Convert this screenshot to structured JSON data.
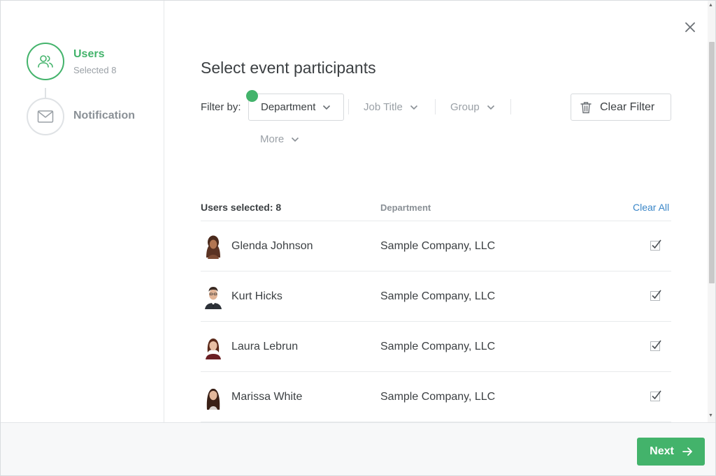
{
  "sidebar": {
    "steps": [
      {
        "title": "Users",
        "subtitle": "Selected 8",
        "icon": "users-icon",
        "active": true
      },
      {
        "title": "Notification",
        "icon": "envelope-icon",
        "active": false
      }
    ]
  },
  "main": {
    "title": "Select event participants",
    "filter_label": "Filter by:",
    "filters": [
      {
        "label": "Department",
        "active": true
      },
      {
        "label": "Job Title",
        "active": false
      },
      {
        "label": "Group",
        "active": false
      },
      {
        "label": "More",
        "active": false
      }
    ],
    "clear_filter_label": "Clear Filter",
    "table": {
      "users_selected_label": "Users selected: 8",
      "department_header": "Department",
      "clear_all_label": "Clear All",
      "rows": [
        {
          "name": "Glenda Johnson",
          "department": "Sample Company, LLC",
          "checked": true
        },
        {
          "name": "Kurt Hicks",
          "department": "Sample Company, LLC",
          "checked": true
        },
        {
          "name": "Laura Lebrun",
          "department": "Sample Company, LLC",
          "checked": true
        },
        {
          "name": "Marissa White",
          "department": "Sample Company, LLC",
          "checked": true
        }
      ]
    }
  },
  "footer": {
    "next_label": "Next"
  },
  "colors": {
    "accent": "#43b36b",
    "link": "#3a86c8",
    "text": "#3c4043",
    "muted": "#9aa0a6"
  }
}
